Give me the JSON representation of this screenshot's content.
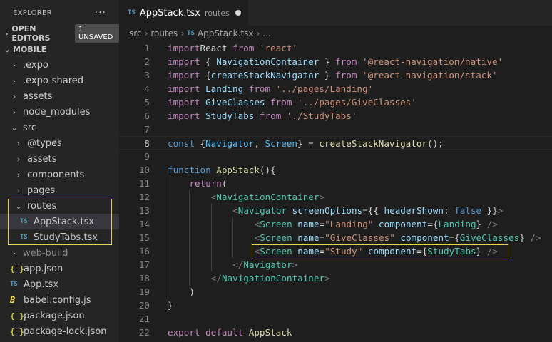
{
  "explorer": {
    "title": "EXPLORER",
    "more": "···",
    "open_editors": {
      "label": "OPEN EDITORS",
      "badge": "1 UNSAVED"
    },
    "workspace": "MOBILE",
    "tree": [
      {
        "label": ".expo",
        "type": "folder",
        "expanded": false,
        "depth": 1
      },
      {
        "label": ".expo-shared",
        "type": "folder",
        "expanded": false,
        "depth": 1
      },
      {
        "label": "assets",
        "type": "folder",
        "expanded": false,
        "depth": 1
      },
      {
        "label": "node_modules",
        "type": "folder",
        "expanded": false,
        "depth": 1
      },
      {
        "label": "src",
        "type": "folder",
        "expanded": true,
        "depth": 1
      },
      {
        "label": "@types",
        "type": "folder",
        "expanded": false,
        "depth": 2
      },
      {
        "label": "assets",
        "type": "folder",
        "expanded": false,
        "depth": 2
      },
      {
        "label": "components",
        "type": "folder",
        "expanded": false,
        "depth": 2
      },
      {
        "label": "pages",
        "type": "folder",
        "expanded": false,
        "depth": 2
      },
      {
        "label": "routes",
        "type": "folder",
        "expanded": true,
        "depth": 2
      },
      {
        "label": "AppStack.tsx",
        "type": "ts",
        "depth": 3,
        "selected": true
      },
      {
        "label": "StudyTabs.tsx",
        "type": "ts",
        "depth": 3
      },
      {
        "label": "web-build",
        "type": "folder",
        "expanded": false,
        "depth": 1,
        "dim": true
      },
      {
        "label": "app.json",
        "type": "json",
        "depth": 1
      },
      {
        "label": "App.tsx",
        "type": "ts",
        "depth": 1
      },
      {
        "label": "babel.config.js",
        "type": "babel",
        "depth": 1
      },
      {
        "label": "package.json",
        "type": "json",
        "depth": 1
      },
      {
        "label": "package-lock.json",
        "type": "json",
        "depth": 1
      }
    ]
  },
  "icons": {
    "ts": "TS",
    "json": "{ }",
    "babel": "B",
    "chevron_right": "›",
    "chevron_down": "⌄"
  },
  "tab": {
    "icon": "TS",
    "name": "AppStack.tsx",
    "path": "routes"
  },
  "breadcrumb": [
    "src",
    "routes",
    "AppStack.tsx",
    "..."
  ],
  "editor": {
    "current_line": 8,
    "lines": [
      {
        "n": "1",
        "tokens": [
          [
            "kc",
            "import"
          ],
          [
            "",
            "React "
          ],
          [
            "kc",
            "from"
          ],
          [
            "",
            ""
          ],
          [
            "st",
            " 'react'"
          ]
        ]
      },
      {
        "n": "2",
        "tokens": [
          [
            "kc",
            "import"
          ],
          [
            "",
            " { "
          ],
          [
            "vr",
            "NavigationContainer"
          ],
          [
            "",
            " } "
          ],
          [
            "kc",
            "from"
          ],
          [
            "st",
            " '@react-navigation/native'"
          ]
        ]
      },
      {
        "n": "3",
        "tokens": [
          [
            "kc",
            "import"
          ],
          [
            "",
            " {"
          ],
          [
            "vr",
            "createStackNavigator"
          ],
          [
            "",
            " } "
          ],
          [
            "kc",
            "from"
          ],
          [
            "st",
            " '@react-navigation/stack'"
          ]
        ]
      },
      {
        "n": "4",
        "tokens": [
          [
            "kc",
            "import"
          ],
          [
            "vr",
            " Landing "
          ],
          [
            "kc",
            "from"
          ],
          [
            "st",
            " '../pages/Landing'"
          ]
        ]
      },
      {
        "n": "5",
        "tokens": [
          [
            "kc",
            "import"
          ],
          [
            "vr",
            " GiveClasses "
          ],
          [
            "kc",
            "from"
          ],
          [
            "st",
            " '../pages/GiveClasses'"
          ]
        ]
      },
      {
        "n": "6",
        "tokens": [
          [
            "kc",
            "import"
          ],
          [
            "vr",
            " StudyTabs "
          ],
          [
            "kc",
            "from"
          ],
          [
            "st",
            " './StudyTabs'"
          ]
        ]
      },
      {
        "n": "7",
        "tokens": []
      },
      {
        "n": "8",
        "tokens": [
          [
            "kw",
            "const"
          ],
          [
            "",
            " {"
          ],
          [
            "cn",
            "Navigator"
          ],
          [
            "",
            ", "
          ],
          [
            "cn",
            "Screen"
          ],
          [
            "",
            "} = "
          ],
          [
            "fn",
            "createStackNavigator"
          ],
          [
            "",
            "();"
          ]
        ]
      },
      {
        "n": "9",
        "tokens": []
      },
      {
        "n": "10",
        "tokens": [
          [
            "kw",
            "function"
          ],
          [
            "fn",
            " AppStack"
          ],
          [
            "",
            "(){"
          ]
        ]
      },
      {
        "n": "11",
        "indent": 1,
        "tokens": [
          [
            "kc",
            "return"
          ],
          [
            "",
            "("
          ]
        ]
      },
      {
        "n": "12",
        "indent": 2,
        "tokens": [
          [
            "tg",
            "<"
          ],
          [
            "ty",
            "NavigationContainer"
          ],
          [
            "tg",
            ">"
          ]
        ]
      },
      {
        "n": "13",
        "indent": 3,
        "tokens": [
          [
            "tg",
            "<"
          ],
          [
            "ty",
            "Navigator"
          ],
          [
            "vr",
            " screenOptions"
          ],
          [
            "",
            "={{ "
          ],
          [
            "vr",
            "headerShown"
          ],
          [
            "",
            ": "
          ],
          [
            "kw",
            "false"
          ],
          [
            "",
            " }}"
          ],
          [
            "tg",
            ">"
          ]
        ]
      },
      {
        "n": "14",
        "indent": 4,
        "tokens": [
          [
            "tg",
            "<"
          ],
          [
            "ty",
            "Screen"
          ],
          [
            "vr",
            " name"
          ],
          [
            "",
            "="
          ],
          [
            "st",
            "\"Landing\""
          ],
          [
            "vr",
            " component"
          ],
          [
            "",
            "={"
          ],
          [
            "ty",
            "Landing"
          ],
          [
            "",
            "} "
          ],
          [
            "tg",
            "/>"
          ]
        ]
      },
      {
        "n": "15",
        "indent": 4,
        "tokens": [
          [
            "tg",
            "<"
          ],
          [
            "ty",
            "Screen"
          ],
          [
            "vr",
            " name"
          ],
          [
            "",
            "="
          ],
          [
            "st",
            "\"GiveClasses\""
          ],
          [
            "vr",
            " component"
          ],
          [
            "",
            "={"
          ],
          [
            "ty",
            "GiveClasses"
          ],
          [
            "",
            "} "
          ],
          [
            "tg",
            "/>"
          ]
        ]
      },
      {
        "n": "16",
        "indent": 4,
        "tokens": [
          [
            "tg",
            "<"
          ],
          [
            "ty",
            "Screen"
          ],
          [
            "vr",
            " name"
          ],
          [
            "",
            "="
          ],
          [
            "st",
            "\"Study\""
          ],
          [
            "vr",
            " component"
          ],
          [
            "",
            "={"
          ],
          [
            "ty",
            "StudyTabs"
          ],
          [
            "",
            "} "
          ],
          [
            "tg",
            "/>"
          ]
        ]
      },
      {
        "n": "17",
        "indent": 3,
        "tokens": [
          [
            "tg",
            "</"
          ],
          [
            "ty",
            "Navigator"
          ],
          [
            "tg",
            ">"
          ]
        ]
      },
      {
        "n": "18",
        "indent": 2,
        "tokens": [
          [
            "tg",
            "</"
          ],
          [
            "ty",
            "NavigationContainer"
          ],
          [
            "tg",
            ">"
          ]
        ]
      },
      {
        "n": "19",
        "indent": 1,
        "tokens": [
          [
            "",
            ")"
          ]
        ]
      },
      {
        "n": "20",
        "tokens": [
          [
            "",
            "}"
          ]
        ]
      },
      {
        "n": "21",
        "tokens": []
      },
      {
        "n": "22",
        "tokens": [
          [
            "kc",
            "export"
          ],
          [
            "kc",
            " default"
          ],
          [
            "fn",
            " AppStack"
          ]
        ]
      }
    ]
  },
  "colors": {
    "highlight_box": "#e8d44d",
    "ts_icon": "#519aba",
    "json_icon": "#cbcb41"
  }
}
